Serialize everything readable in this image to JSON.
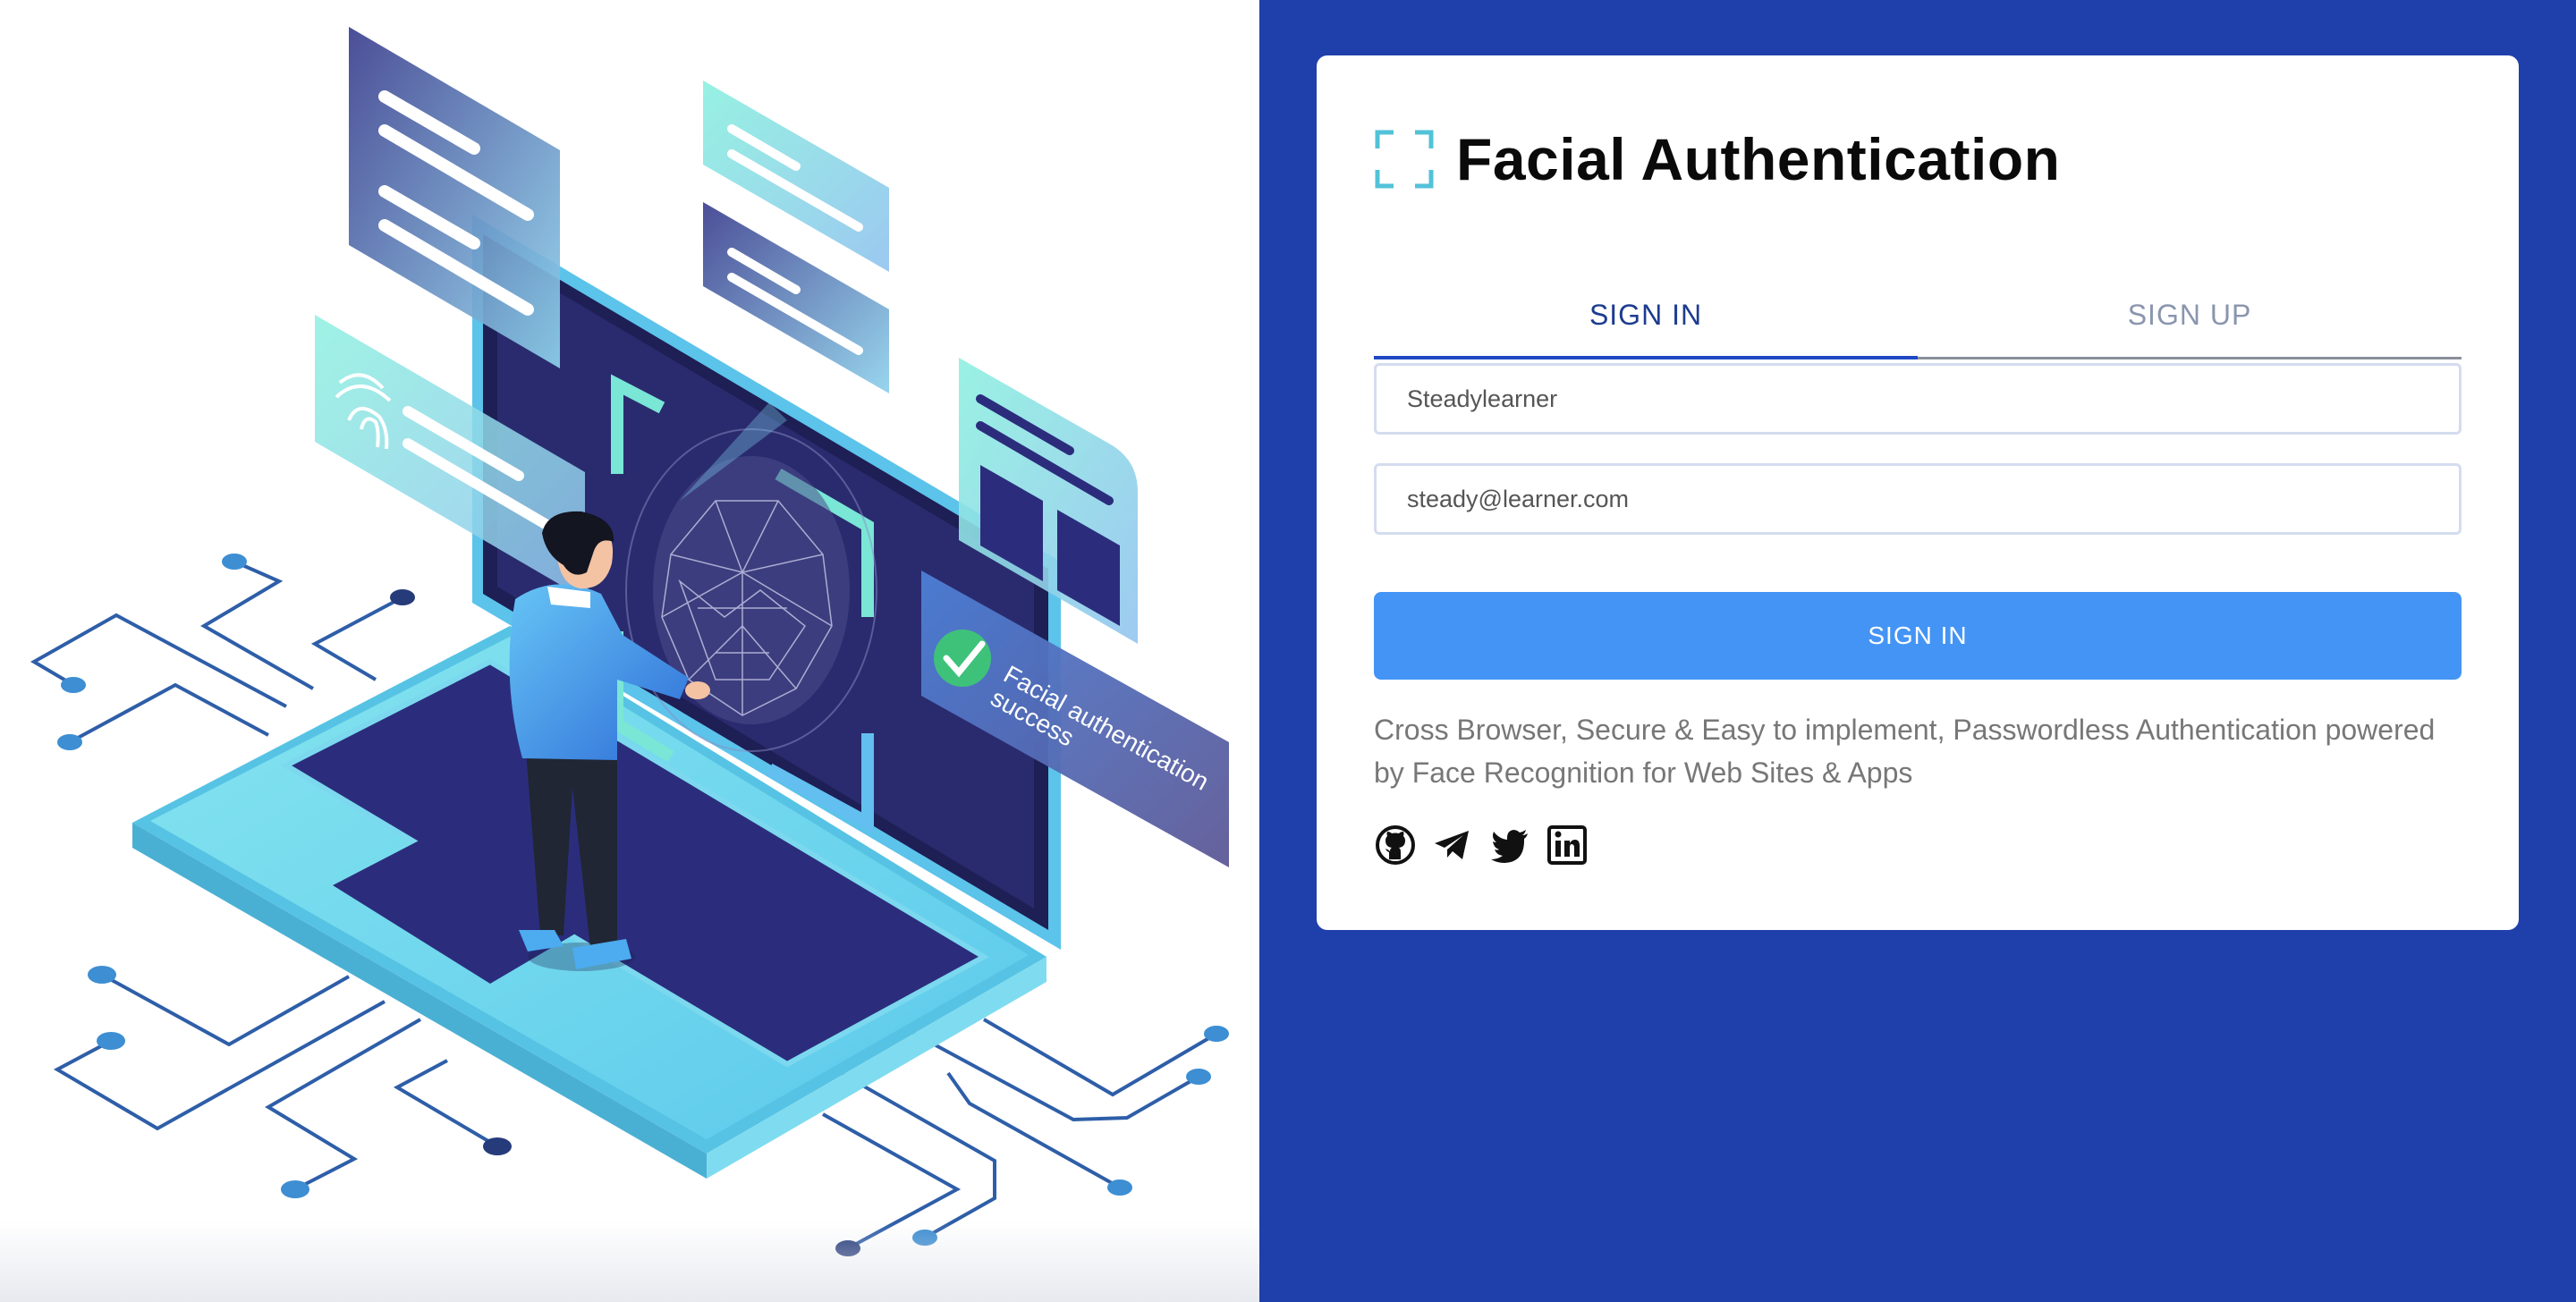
{
  "brand": {
    "title": "Facial Authentication",
    "icon": "face-scan-frame-icon",
    "icon_color": "#52c2d8"
  },
  "tabs": [
    {
      "label": "SIGN IN",
      "active": true
    },
    {
      "label": "SIGN UP",
      "active": false
    }
  ],
  "form": {
    "username_value": "Steadylearner",
    "email_value": "steady@learner.com",
    "submit_label": "SIGN IN"
  },
  "tagline": "Cross Browser, Secure & Easy to implement, Passwordless Authentication powered by Face Recognition for Web Sites & Apps",
  "socials": [
    {
      "icon": "github-icon"
    },
    {
      "icon": "telegram-icon"
    },
    {
      "icon": "twitter-icon"
    },
    {
      "icon": "linkedin-icon"
    }
  ],
  "illustration": {
    "success_text_line1": "Facial authentication",
    "success_text_line2": "success"
  },
  "colors": {
    "page_background": "#1f3fab",
    "card_background": "#ffffff",
    "primary_button": "#4394f5",
    "active_tab": "#1c3c8f",
    "inactive_tab": "#8a95ad",
    "tagline": "#777777"
  }
}
